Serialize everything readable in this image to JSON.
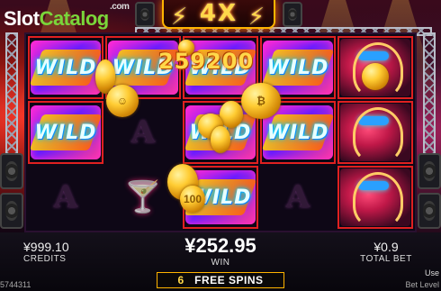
{
  "branding": {
    "logo_slot": "Slot",
    "logo_catalog": "Catalog",
    "logo_com": ".com"
  },
  "multiplier": {
    "label": "4X"
  },
  "win_banner": {
    "amount": "259200"
  },
  "reels": {
    "columns": [
      [
        "wild",
        "wild",
        "symbol-a"
      ],
      [
        "wild",
        "symbol-a",
        "cocktail"
      ],
      [
        "wild",
        "wild",
        "wild"
      ],
      [
        "wild",
        "wild",
        "symbol-a"
      ],
      [
        "singer",
        "singer",
        "singer"
      ]
    ],
    "wild_text": "WILD",
    "a_text": "A",
    "cocktail_glyph": "🍸"
  },
  "bottom_bar": {
    "credits_value": "¥999.10",
    "credits_label": "CREDITS",
    "win_value": "¥252.95",
    "win_label": "WIN",
    "total_bet_value": "¥0.9",
    "total_bet_label": "TOTAL BET",
    "free_spins_count": "6",
    "free_spins_label": "FREE SPINS",
    "footer_left": "5744311",
    "footer_right_top": "Use",
    "footer_right": "Bet Level"
  },
  "colors": {
    "accent_gold": "#ffd84a",
    "reel_frame": "#e02020",
    "brand_green": "#7ad63a"
  }
}
